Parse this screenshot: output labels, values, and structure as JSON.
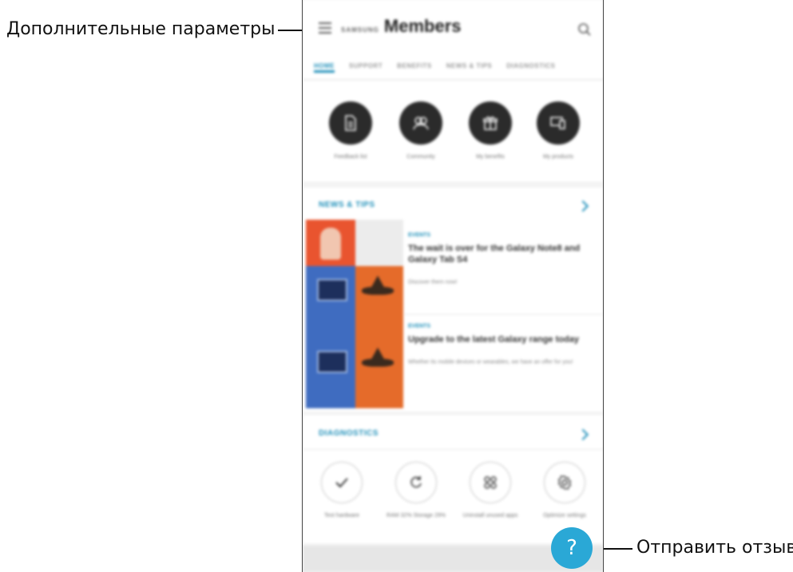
{
  "callouts": {
    "menu": "Дополнительные параметры",
    "feedback": "Отправить отзыв"
  },
  "app": {
    "brand_small": "SAMSUNG",
    "title": "Members"
  },
  "tabs": [
    {
      "label": "HOME",
      "active": true
    },
    {
      "label": "SUPPORT"
    },
    {
      "label": "BENEFITS"
    },
    {
      "label": "NEWS & TIPS"
    },
    {
      "label": "DIAGNOSTICS"
    }
  ],
  "quick_actions": [
    {
      "label": "Feedback list",
      "icon": "document-icon"
    },
    {
      "label": "Community",
      "icon": "community-icon"
    },
    {
      "label": "My benefits",
      "icon": "gift-icon"
    },
    {
      "label": "My products",
      "icon": "devices-icon"
    }
  ],
  "news": {
    "header": "NEWS & TIPS",
    "items": [
      {
        "tag": "EVENTS",
        "title": "The wait is over for the Galaxy Note8 and Galaxy Tab S4",
        "subtitle": "Discover them now!"
      },
      {
        "tag": "EVENTS",
        "title": "Upgrade to the latest Galaxy range today",
        "subtitle": "Whether its mobile devices or wearables, we have an offer for you!"
      }
    ]
  },
  "diagnostics": {
    "header": "DIAGNOSTICS",
    "items": [
      {
        "label": "Test hardware",
        "icon": "check-icon"
      },
      {
        "label": "RAM 32% Storage 29%",
        "icon": "refresh-icon"
      },
      {
        "label": "Uninstall unused apps",
        "icon": "apps-icon"
      },
      {
        "label": "Optimize settings",
        "icon": "gear-icon"
      }
    ]
  },
  "fab": {
    "label": "?"
  },
  "colors": {
    "accent": "#1e8fb9",
    "fab": "#2aa8d6",
    "dark_circle": "#2b2b2b"
  }
}
